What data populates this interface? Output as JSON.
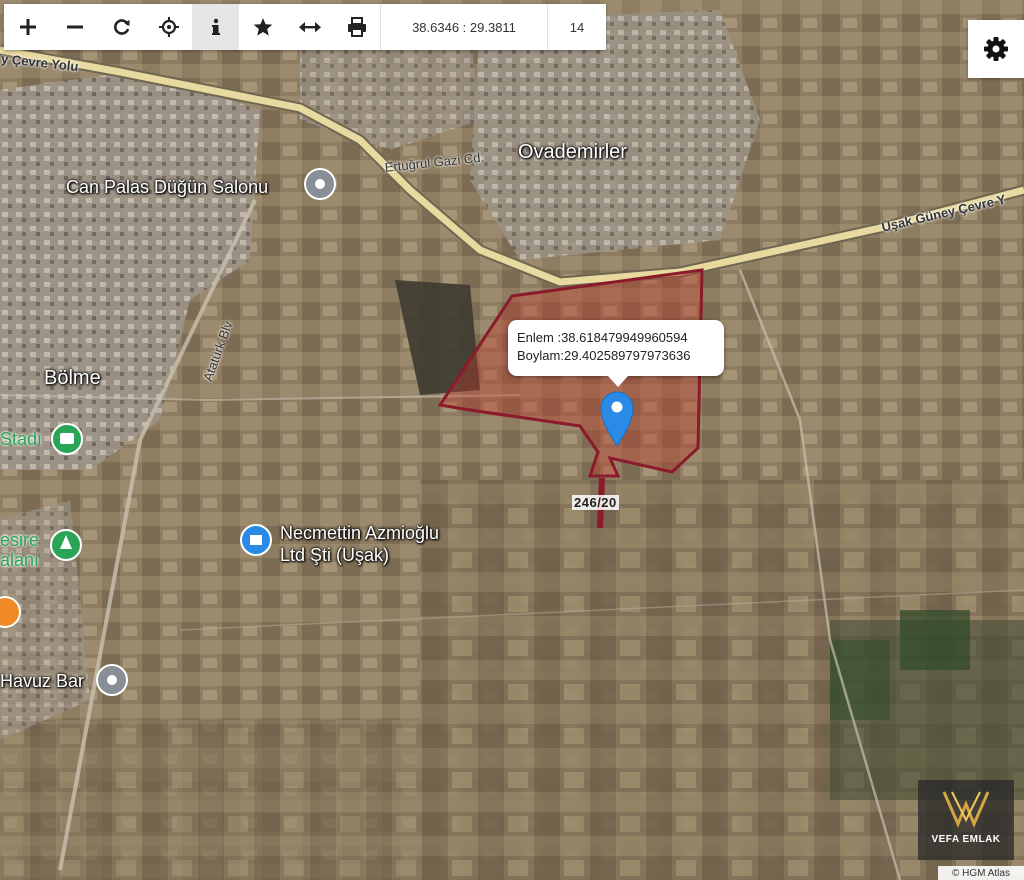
{
  "toolbar": {
    "buttons": [
      {
        "icon": "zoom-in-icon",
        "glyph": "+"
      },
      {
        "icon": "zoom-out-icon",
        "glyph": "−"
      },
      {
        "icon": "refresh-icon",
        "glyph": "⟳"
      },
      {
        "icon": "locate-icon",
        "glyph": "⌖"
      },
      {
        "icon": "info-icon",
        "glyph": "i"
      },
      {
        "icon": "star-icon",
        "glyph": "★"
      },
      {
        "icon": "measure-icon",
        "glyph": "↔"
      },
      {
        "icon": "print-icon",
        "glyph": "⎙"
      }
    ],
    "coordinates": "38.6346 : 29.3811",
    "zoom": "14"
  },
  "settings": {
    "icon": "gear-icon"
  },
  "labels": {
    "cevre_yolu": "y Çevre Yolu",
    "ovademirler": "Ovademirler",
    "ertugrul": "Ertuğrul Gazi Cd.",
    "can_palas": "Can Palas Düğün Salonu",
    "usak_guney": "Uşak Güney Çevre Y",
    "ataturk": "Atatürk Blv",
    "bolme": "Bölme",
    "stadi": "Stadı",
    "mesire_1": "esire",
    "mesire_2": "alanı",
    "necmettin_1": "Necmettin Azmioğlu",
    "necmettin_2": "Ltd Şti (Uşak)",
    "havuz_bar": "Havuz Bar",
    "parcel": "246/20"
  },
  "popup": {
    "enlem": "Enlem :38.618479949960594",
    "boylam": "Boylam:29.402589797973636"
  },
  "branding": {
    "logo_text": "VEFA EMLAK",
    "attribution": "© HGM Atlas"
  },
  "colors": {
    "parcel_stroke": "#8b1a2c",
    "parcel_fill": "#c0392b",
    "marker": "#2a8be6",
    "highway": "#e8d9a0"
  }
}
